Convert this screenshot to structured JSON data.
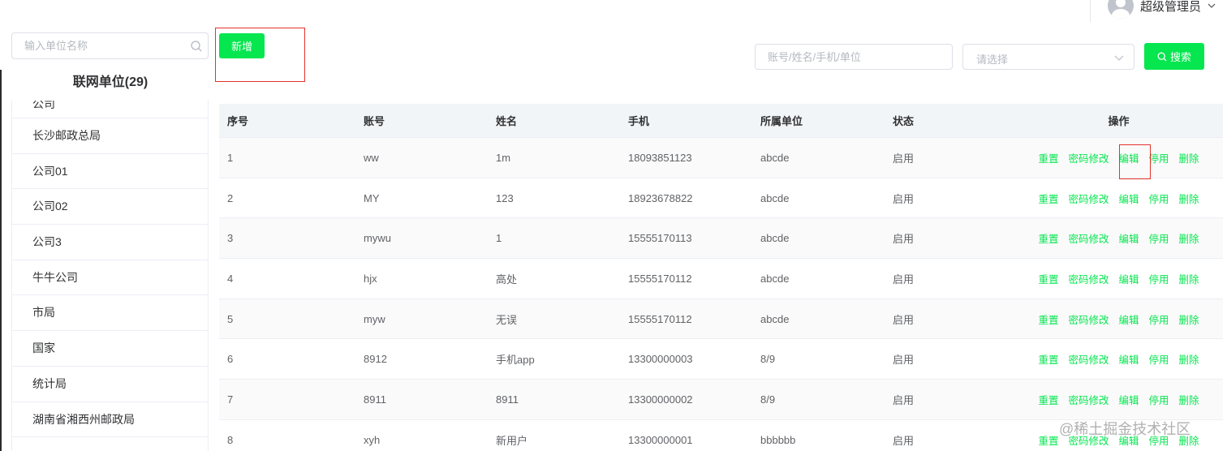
{
  "header": {
    "user_name": "超级管理员",
    "avatar_icon": "user-avatar-icon",
    "dropdown_icon": "chevron-down-icon"
  },
  "left_panel": {
    "search_placeholder": "输入单位名称",
    "title": "联网单位(29)",
    "units": [
      "公司",
      "长沙邮政总局",
      "公司01",
      "公司02",
      "公司3",
      "牛牛公司",
      "市局",
      "国家",
      "统计局",
      "湖南省湘西州邮政局"
    ]
  },
  "toolbar": {
    "add_label": "新增",
    "keyword_placeholder": "账号/姓名/手机/单位",
    "select_placeholder": "请选择",
    "search_label": "搜索"
  },
  "table": {
    "headers": [
      "序号",
      "账号",
      "姓名",
      "手机",
      "所属单位",
      "状态",
      "操作"
    ],
    "rows": [
      [
        "1",
        "ww",
        "1m",
        "18093851123",
        "abcde",
        "启用"
      ],
      [
        "2",
        "MY",
        "123",
        "18923678822",
        "abcde",
        "启用"
      ],
      [
        "3",
        "mywu",
        "1",
        "15555170113",
        "abcde",
        "启用"
      ],
      [
        "4",
        "hjx",
        "高处",
        "15555170112",
        "abcde",
        "启用"
      ],
      [
        "5",
        "myw",
        "无误",
        "15555170112",
        "abcde",
        "启用"
      ],
      [
        "6",
        "8912",
        "手机app",
        "13300000003",
        "8/9",
        "启用"
      ],
      [
        "7",
        "8911",
        "8911",
        "13300000002",
        "8/9",
        "启用"
      ],
      [
        "8",
        "xyh",
        "新用户",
        "13300000001",
        "bbbbbb",
        "启用"
      ]
    ],
    "actions": [
      "重置",
      "密码修改",
      "编辑",
      "停用",
      "删除"
    ]
  },
  "colors": {
    "accent": "#05e64f",
    "highlight": "#e5322d"
  },
  "watermark": "@稀土掘金技术社区"
}
